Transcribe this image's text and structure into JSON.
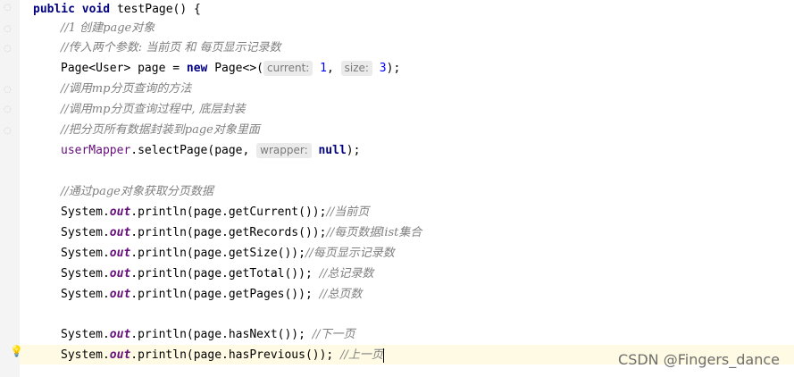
{
  "editor": {
    "lines": {
      "l1": {
        "kw1": "public",
        "kw2": "void",
        "rest": "testPage() {"
      },
      "l2": {
        "comment": "//1 创建page对象"
      },
      "l3": {
        "comment": "//传入两个参数: 当前页 和 每页显示记录数"
      },
      "l4": {
        "pre": "Page<User> page = ",
        "kw": "new",
        "mid": "Page<>(",
        "hint1": "current:",
        "v1": "1",
        "sep": ", ",
        "hint2": "size:",
        "v2": "3",
        "post": ");"
      },
      "l5": {
        "comment": "//调用mp分页查询的方法"
      },
      "l6": {
        "comment": "//调用mp分页查询过程中, 底层封装"
      },
      "l7": {
        "comment": "//把分页所有数据封装到page对象里面"
      },
      "l8": {
        "var": "userMapper",
        "mid": ".selectPage(page, ",
        "hint": "wrapper:",
        "kw": "null",
        "post": ");"
      },
      "l9": {
        "comment": "//通过page对象获取分页数据"
      },
      "l10": {
        "pre": "System.",
        "field": "out",
        "code": ".println(page.getCurrent());",
        "comment": "//当前页"
      },
      "l11": {
        "pre": "System.",
        "field": "out",
        "code": ".println(page.getRecords());",
        "comment": "//每页数据list集合"
      },
      "l12": {
        "pre": "System.",
        "field": "out",
        "code": ".println(page.getSize());",
        "comment": "//每页显示记录数"
      },
      "l13": {
        "pre": "System.",
        "field": "out",
        "code": ".println(page.getTotal()); ",
        "comment": "//总记录数"
      },
      "l14": {
        "pre": "System.",
        "field": "out",
        "code": ".println(page.getPages()); ",
        "comment": "//总页数"
      },
      "l15": {
        "pre": "System.",
        "field": "out",
        "code": ".println(page.hasNext()); ",
        "comment": "//下一页"
      },
      "l16": {
        "pre": "System.",
        "field": "out",
        "code": ".println(page.hasPrevious()); ",
        "comment": "//上一页"
      }
    },
    "icons": {
      "gutter": "fold-marker-icon",
      "intention": "lightbulb-icon"
    }
  },
  "watermark": "CSDN @Fingers_dance",
  "colors": {
    "keyword": "#000080",
    "comment": "#808080",
    "field": "#660e7a",
    "number": "#0000ff",
    "caret_line": "#fffae3"
  }
}
